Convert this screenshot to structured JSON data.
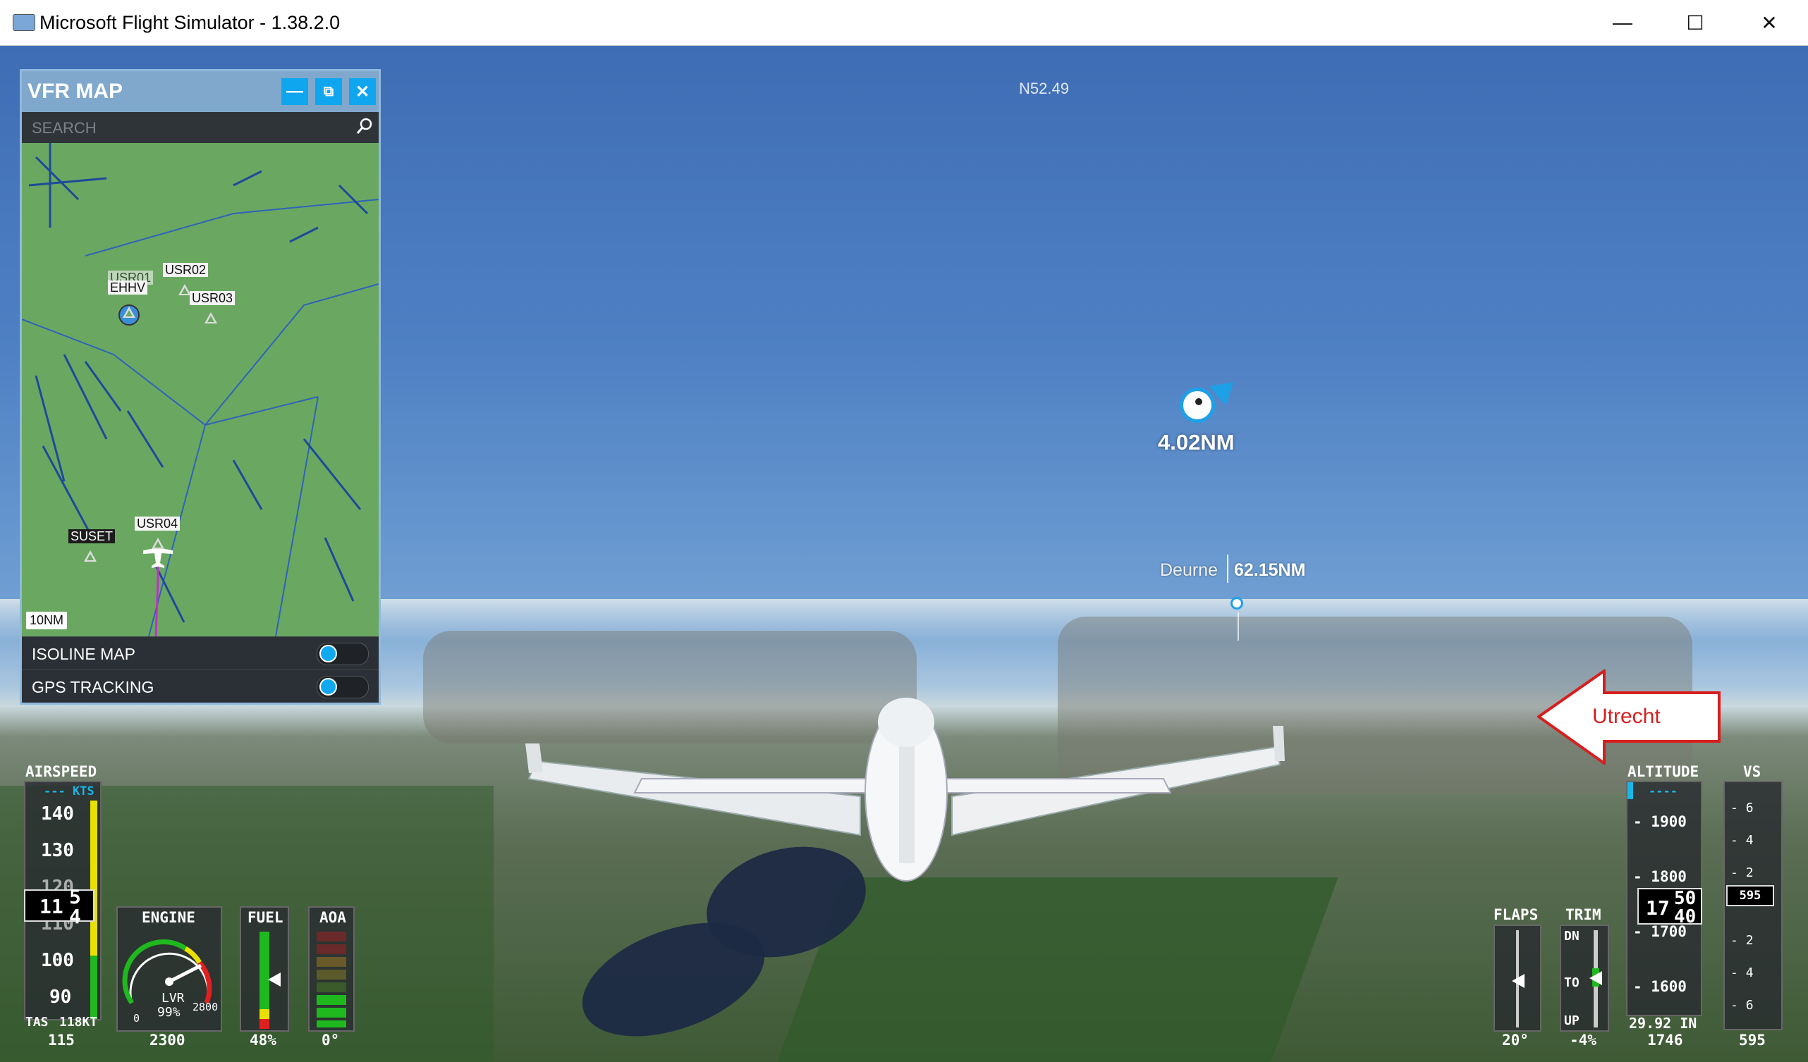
{
  "window": {
    "title": "Microsoft Flight Simulator - 1.38.2.0",
    "minimize": "—",
    "maximize": "☐",
    "close": "✕"
  },
  "scene": {
    "top_partial_text": "N52.49",
    "poi_distance": "4.02NM",
    "waypoint_name": "Deurne",
    "waypoint_distance": "62.15NM",
    "callout_label": "Utrecht",
    "callout_color": "#d71f1f"
  },
  "vfr_map": {
    "title": "VFR MAP",
    "search_placeholder": "SEARCH",
    "labels": {
      "ehhv": "EHHV",
      "usr01": "USR01",
      "usr02": "USR02",
      "usr03": "USR03",
      "usr04": "USR04",
      "suset": "SUSET"
    },
    "scale": "10NM",
    "rows": [
      {
        "label": "ISOLINE MAP",
        "on": true
      },
      {
        "label": "GPS TRACKING",
        "on": true
      }
    ],
    "accent": "#10a8ef",
    "map_green": "#6aa862"
  },
  "airspeed": {
    "label": "AIRSPEED",
    "bug": "--- KTS",
    "ticks": [
      "140",
      "130",
      "120",
      "110",
      "100",
      "90"
    ],
    "current_a": "11",
    "current_b": "5",
    "current_c": "4",
    "tas_label": "TAS",
    "tas_value": "118KT",
    "bottom_value": "115"
  },
  "engine": {
    "label": "ENGINE",
    "lvr_label": "LVR",
    "lvr_value": "99%",
    "scale_min": "0",
    "scale_max": "2800",
    "rpm": "2300"
  },
  "fuel": {
    "label": "FUEL",
    "value": "48%",
    "level": 0.48
  },
  "aoa": {
    "label": "AOA",
    "value": "0°"
  },
  "flaps": {
    "label": "FLAPS",
    "value": "20°"
  },
  "trim": {
    "label": "TRIM",
    "dn": "DN",
    "to": "TO",
    "up": "UP",
    "value": "-4%"
  },
  "altitude": {
    "label": "ALTITUDE",
    "bug": "----",
    "ticks": [
      "1900",
      "1800",
      "1700",
      "1600"
    ],
    "current_a": "17",
    "current_b": "50",
    "current_c": "40",
    "baro": "29.92 IN",
    "bottom_value": "1746"
  },
  "vs": {
    "label": "VS",
    "up_ticks": [
      "6",
      "4",
      "2"
    ],
    "down_ticks": [
      "2",
      "4",
      "6"
    ],
    "current": "595",
    "bottom_value": "595"
  }
}
